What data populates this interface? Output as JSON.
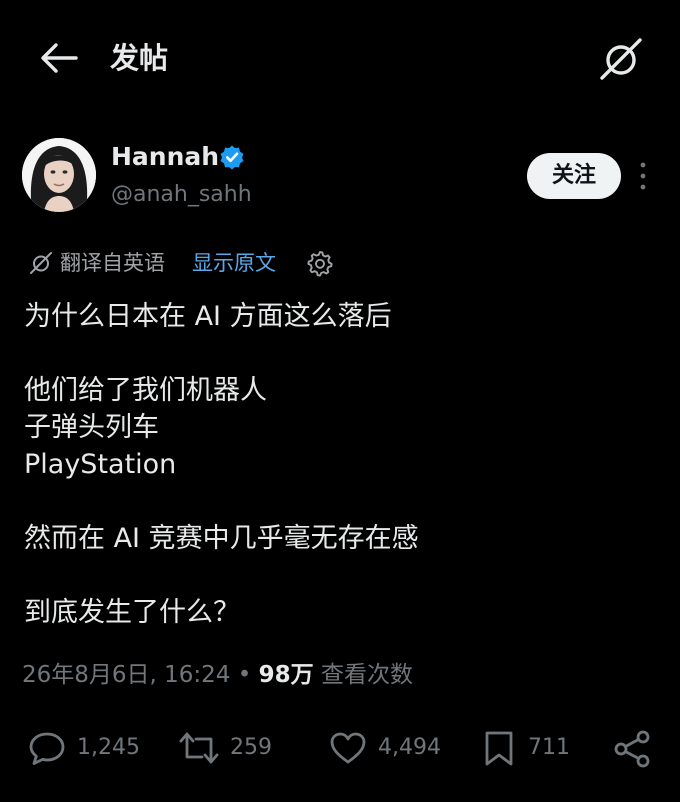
{
  "header": {
    "title": "发帖"
  },
  "author": {
    "display_name": "Hannah",
    "handle": "@anah_sahh",
    "follow_label": "关注"
  },
  "translation": {
    "label": "翻译自英语",
    "show_original": "显示原文"
  },
  "tweet": {
    "line1": "为什么日本在 AI 方面这么落后",
    "line2": "他们给了我们机器人",
    "line3": "子弹头列车",
    "line4": "PlayStation",
    "line5": "然而在 AI 竞赛中几乎毫无存在感",
    "line6": "到底发生了什么？"
  },
  "meta": {
    "timestamp": "26年8月6日, 16:24",
    "separator": " • ",
    "views_count": "98万",
    "views_label": " 查看次数"
  },
  "actions": {
    "replies": "1,245",
    "reposts": "259",
    "likes": "4,494",
    "bookmarks": "711"
  },
  "colors": {
    "background": "#000000",
    "text": "#e7e9ea",
    "secondary": "#71767b",
    "link": "#5aa8e8",
    "verified": "#1d9bf0"
  }
}
